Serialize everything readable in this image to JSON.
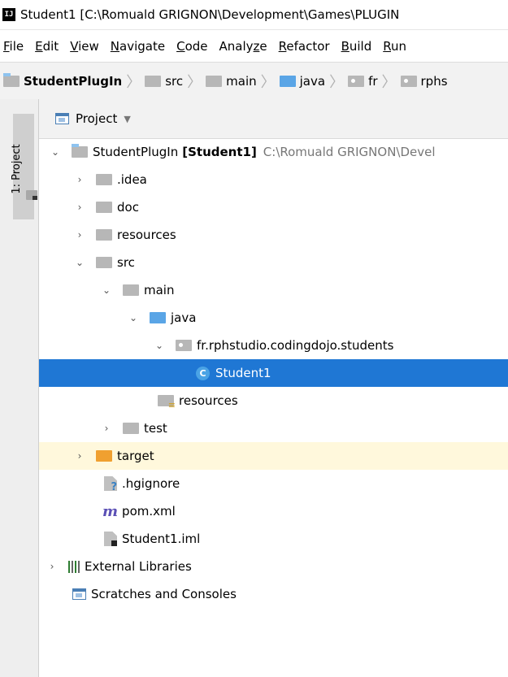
{
  "window": {
    "app_icon": "IJ",
    "title": "Student1 [C:\\Romuald GRIGNON\\Development\\Games\\PLUGIN"
  },
  "menu": [
    {
      "pre": "",
      "u": "F",
      "post": "ile"
    },
    {
      "pre": "",
      "u": "E",
      "post": "dit"
    },
    {
      "pre": "",
      "u": "V",
      "post": "iew"
    },
    {
      "pre": "",
      "u": "N",
      "post": "avigate"
    },
    {
      "pre": "",
      "u": "C",
      "post": "ode"
    },
    {
      "pre": "Analy",
      "u": "z",
      "post": "e"
    },
    {
      "pre": "",
      "u": "R",
      "post": "efactor"
    },
    {
      "pre": "",
      "u": "B",
      "post": "uild"
    },
    {
      "pre": "",
      "u": "R",
      "post": "un"
    }
  ],
  "breadcrumb": [
    "StudentPlugIn",
    "src",
    "main",
    "java",
    "fr",
    "rphs"
  ],
  "sidebar": {
    "tab_label": "1: Project"
  },
  "panel": {
    "title": "Project"
  },
  "tree": {
    "root_name": "StudentPlugIn",
    "root_module": "[Student1]",
    "root_path": "C:\\Romuald GRIGNON\\Devel",
    "idea": ".idea",
    "doc": "doc",
    "resources": "resources",
    "src": "src",
    "main": "main",
    "java": "java",
    "package": "fr.rphstudio.codingdojo.students",
    "class_badge": "C",
    "class_name": "Student1",
    "main_resources": "resources",
    "test": "test",
    "target": "target",
    "hgignore": ".hgignore",
    "maven_badge": "m",
    "pom": "pom.xml",
    "iml": "Student1.iml",
    "external_libs": "External Libraries",
    "scratches": "Scratches and Consoles"
  }
}
